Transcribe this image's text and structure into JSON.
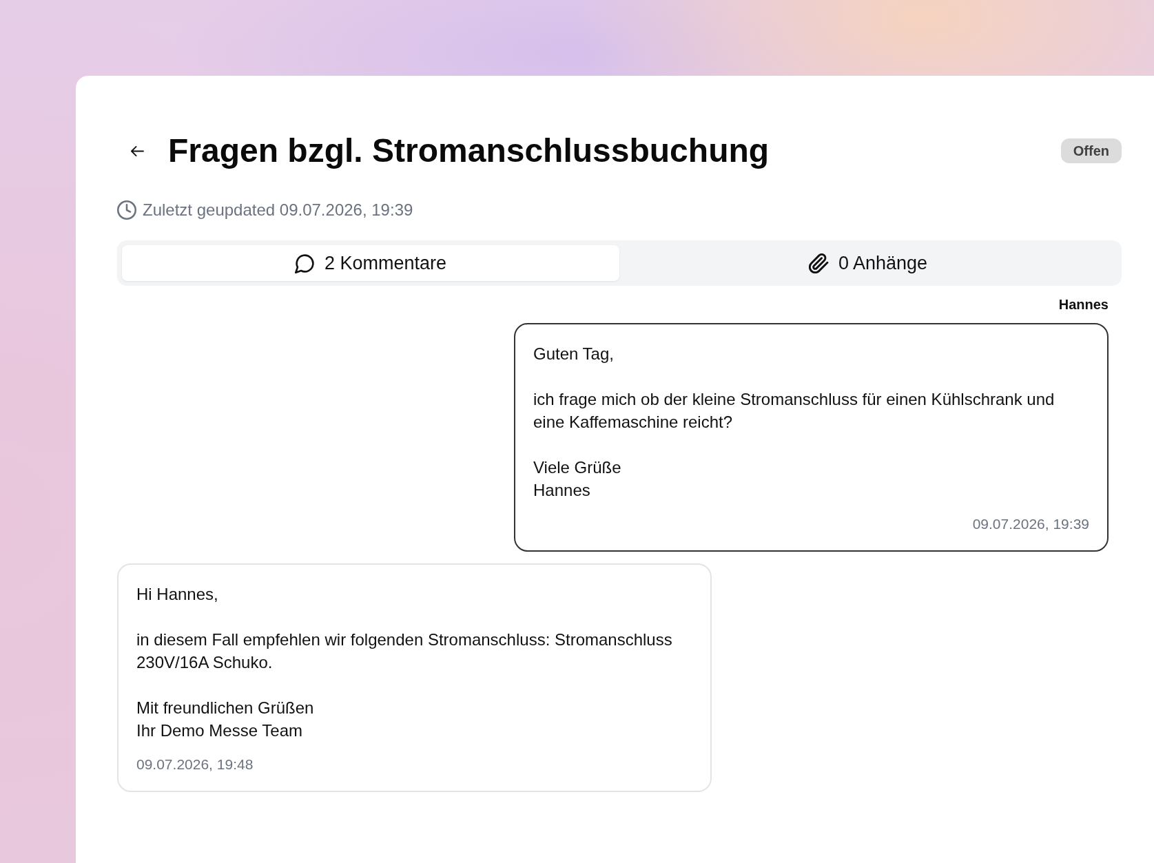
{
  "header": {
    "title": "Fragen bzgl. Stromanschlussbuchung",
    "status": "Offen",
    "last_updated": "Zuletzt geupdated 09.07.2026, 19:39"
  },
  "tabs": [
    {
      "kind": "comments",
      "label": "2 Kommentare",
      "selected": true
    },
    {
      "kind": "attachments",
      "label": "0 Anhänge",
      "selected": false
    }
  ],
  "messages": [
    {
      "kind": "outgoing",
      "author": "Hannes",
      "body": "Guten Tag,\n\nich frage mich ob der kleine Stromanschluss für einen Kühlschrank und eine Kaffemaschine reicht?\n\nViele Grüße\nHannes",
      "time": "09.07.2026, 19:39"
    },
    {
      "kind": "incoming",
      "body": "Hi Hannes,\n\nin diesem Fall empfehlen wir folgenden Stromanschluss: Stromanschluss 230V/16A Schuko.\n\nMit freundlichen Grüßen\nIhr Demo Messe Team",
      "time": "09.07.2026, 19:48"
    }
  ]
}
